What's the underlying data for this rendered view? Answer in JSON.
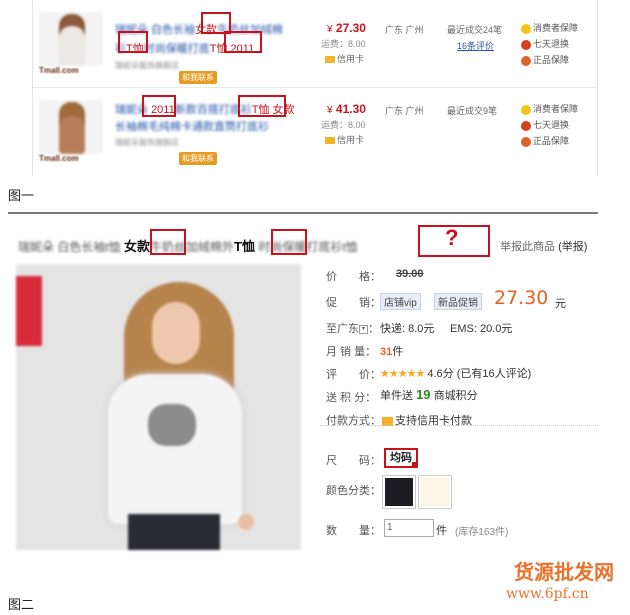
{
  "figure1": {
    "caption": "图一",
    "items": [
      {
        "title_blur_a": "瑞妮朵 白色长袖",
        "title_kw_a": "女款",
        "title_blur_b": "牛奶丝加绒棉",
        "title_kw_b": "T恤",
        "title_blur_c": "时尚保暖打底",
        "title_kw_c": "T恤",
        "title_kw_d": "2011",
        "brand_logo": "Tmall.com",
        "ww_label": "和我联系",
        "seller_blur": "瑞妮朵服饰旗舰店",
        "price_symbol": "¥",
        "price": "27.30",
        "shipping": "运费：8.00",
        "credit_card": "信用卡",
        "location": "广东 广州",
        "deals": "最近成交24笔",
        "reviews": "16条评价",
        "services": [
          "消费者保障",
          "七天退换",
          "正品保障"
        ]
      },
      {
        "title_kw_a": "2011",
        "title_blur_a": "新款百搭打底衫",
        "title_kw_b": "T恤 女款",
        "title_blur_b": "长袖棉毛纯棉卡通款直筒打底衫",
        "brand_logo": "Tmall.com",
        "ww_label": "和我联系",
        "seller_blur": "瑞妮朵服饰旗舰店",
        "price_symbol": "¥",
        "price": "41.30",
        "shipping": "运费：8.00",
        "credit_card": "信用卡",
        "location": "广东 广州",
        "deals": "最近成交9笔",
        "services": [
          "消费者保障",
          "七天退换",
          "正品保障"
        ]
      }
    ],
    "colors": {
      "keyword_box": "#c8111d",
      "title_link": "#2755a8",
      "price": "#c8111d"
    }
  },
  "figure2": {
    "caption": "图二",
    "title_blur_a": "瑞妮朵 白色长袖t恤",
    "title_kw_a": "女款",
    "title_blur_b": "牛奶丝加绒棉外",
    "title_kw_b": "T恤",
    "title_blur_c": "时尚保暖打底衫t恤",
    "question_mark": "?",
    "report_link": "举报此商品",
    "report_button": "(举报)",
    "labels": {
      "price": "价　　格：",
      "promo": "促　　销：",
      "ship_to": "至广东",
      "monthly": "月 销 量：",
      "rating": "评　　价：",
      "points": "送 积 分：",
      "payment": "付款方式：",
      "size": "尺　　码：",
      "color": "颜色分类：",
      "quantity": "数　　量："
    },
    "original_price": "39.00",
    "promo_tag_vip": "店铺vip",
    "promo_tag_new": "新品促销",
    "promo_price": "27.30",
    "promo_unit": "元",
    "shipping_express": "快递: 8.0元",
    "shipping_ems": "EMS: 20.0元",
    "monthly_sales": "31",
    "monthly_unit": "件",
    "rating_stars": "★★★★★",
    "rating_text": "4.6分 (已有16人评论)",
    "points_prefix": "单件送",
    "points_value": "19",
    "points_suffix": "商城积分",
    "payment_text": "支持信用卡付款",
    "size_option": "均码",
    "color_swatches": [
      "#1c1c22",
      "#fbf6e6"
    ],
    "quantity_value": "1",
    "quantity_unit": "件",
    "stock_text": "(库存163件)",
    "colors": {
      "promo_price": "#e8611f",
      "points": "#2d8a1c",
      "stars": "#f2a91d"
    }
  },
  "watermark": {
    "cn": "货源批发网",
    "url": "www.6pf.cn"
  }
}
